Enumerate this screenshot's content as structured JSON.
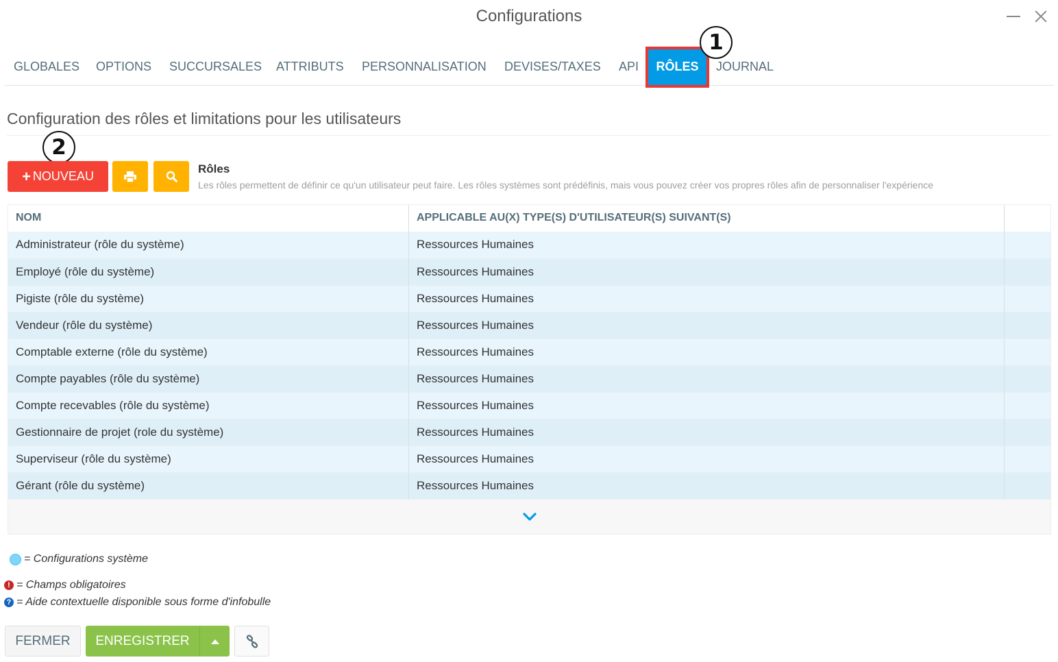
{
  "window": {
    "title": "Configurations"
  },
  "tabs": [
    {
      "label": "GLOBALES",
      "active": false
    },
    {
      "label": "OPTIONS",
      "active": false
    },
    {
      "label": "SUCCURSALES",
      "active": false
    },
    {
      "label": "ATTRIBUTS",
      "active": false
    },
    {
      "label": "PERSONNALISATION",
      "active": false
    },
    {
      "label": "DEVISES/TAXES",
      "active": false
    },
    {
      "label": "API",
      "active": false
    },
    {
      "label": "RÔLES",
      "active": true
    },
    {
      "label": "JOURNAL",
      "active": false
    }
  ],
  "callouts": {
    "first": "1",
    "second": "2"
  },
  "section": {
    "title": "Configuration des rôles et limitations pour les utilisateurs"
  },
  "toolbar": {
    "new_label": "NOUVEAU",
    "icons": [
      "plus-icon",
      "print-icon",
      "search-icon"
    ]
  },
  "description": {
    "title": "Rôles",
    "text": "Les rôles permettent de définir ce qu'un utilisateur peut faire. Les rôles systèmes sont prédéfinis, mais vous pouvez créer vos propres rôles afin de personnaliser l'expérience"
  },
  "table": {
    "columns": [
      "NOM",
      "APPLICABLE AU(X) TYPE(S) D'UTILISATEUR(S) SUIVANT(S)",
      ""
    ],
    "rows": [
      [
        "Administrateur (rôle du système)",
        "Ressources Humaines"
      ],
      [
        "Employé (rôle du système)",
        "Ressources Humaines"
      ],
      [
        "Pigiste (rôle du système)",
        "Ressources Humaines"
      ],
      [
        "Vendeur (rôle du système)",
        "Ressources Humaines"
      ],
      [
        "Comptable externe (rôle du système)",
        "Ressources Humaines"
      ],
      [
        "Compte payables (rôle du système)",
        "Ressources Humaines"
      ],
      [
        "Compte recevables (rôle du système)",
        "Ressources Humaines"
      ],
      [
        "Gestionnaire de projet (role du système)",
        "Ressources Humaines"
      ],
      [
        "Superviseur (rôle du système)",
        "Ressources Humaines"
      ],
      [
        "Gérant (rôle du système)",
        "Ressources Humaines"
      ]
    ],
    "more_icon": "chevron-down-icon"
  },
  "legend": {
    "system": "= Configurations système",
    "required": "= Champs obligatoires",
    "help": "= Aide contextuelle disponible sous forme d'infobulle"
  },
  "footer": {
    "close_label": "FERMER",
    "save_label": "ENREGISTRER"
  },
  "colors": {
    "accent_tab": "#039be5",
    "highlight_box": "#e53935",
    "new_button": "#f44336",
    "tool_button": "#ffb300",
    "save_button": "#8bc34a",
    "row_tint": "#e8f5fc"
  }
}
